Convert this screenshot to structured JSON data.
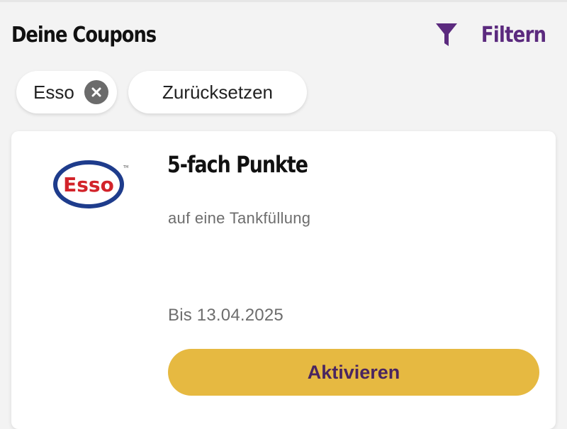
{
  "header": {
    "title": "Deine Coupons",
    "filter_label": "Filtern",
    "filter_icon": "funnel-icon"
  },
  "chips": {
    "active_filter": "Esso",
    "remove_icon": "close-circle-icon",
    "reset_label": "Zurücksetzen"
  },
  "coupon": {
    "brand": "Esso",
    "brand_logo_text": "Esso",
    "title": "5-fach Punkte",
    "subtitle": "auf eine Tankfüllung",
    "validity": "Bis 13.04.2025",
    "activate_label": "Aktivieren"
  },
  "colors": {
    "accent_purple": "#5b2a7e",
    "button_yellow": "#e6b941",
    "esso_red": "#d2232a",
    "esso_blue": "#1e3c8c"
  }
}
